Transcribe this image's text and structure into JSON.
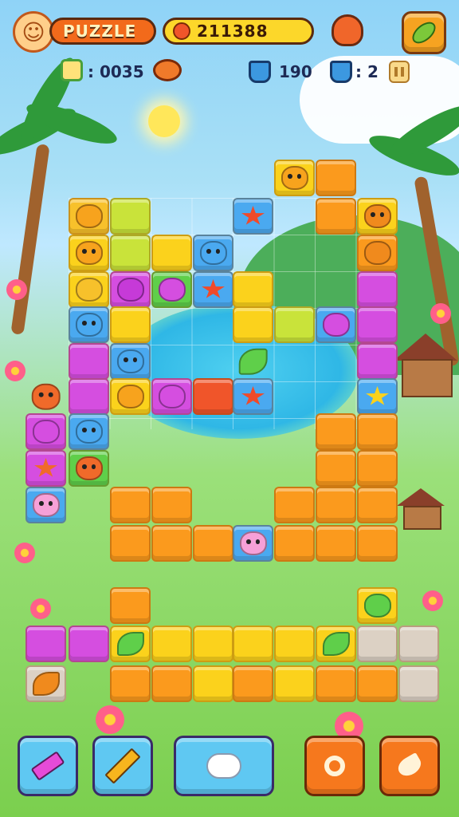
{
  "header": {
    "mode_label": "PUZZLE",
    "coins": "211388",
    "stat_a": ": 0035",
    "stat_b": "190",
    "stat_c": ": 2"
  },
  "icons": {
    "avatar": "face-avatar-icon",
    "coin": "coin-icon",
    "mascot": "fish-mascot-icon",
    "shop": "leaf-shop-icon",
    "cup": "cup-icon",
    "crab": "crab-icon",
    "bucket_a": "bucket-icon",
    "bucket_b": "bucket-icon",
    "pause": "pause-icon"
  },
  "toolbar": [
    {
      "name": "hammer-tool-button",
      "icon": "hammer-icon"
    },
    {
      "name": "pencil-tool-button",
      "icon": "pencil-icon"
    },
    {
      "name": "cloud-tool-button",
      "icon": "cloud-icon"
    },
    {
      "name": "search-tool-button",
      "icon": "search-icon"
    },
    {
      "name": "bird-tool-button",
      "icon": "bird-icon"
    }
  ],
  "colors": {
    "orange": "#fb9a1d",
    "yellow": "#fbd21c",
    "lime": "#c9e33a",
    "magenta": "#d54ee0",
    "blue": "#4aa9f0",
    "red": "#f0552a",
    "grey": "#dcd1c4",
    "hud_orange": "#f26a1b",
    "hud_yellow": "#fcd72a",
    "button_blue": "#5fc8f2",
    "button_orange": "#f6781d"
  }
}
